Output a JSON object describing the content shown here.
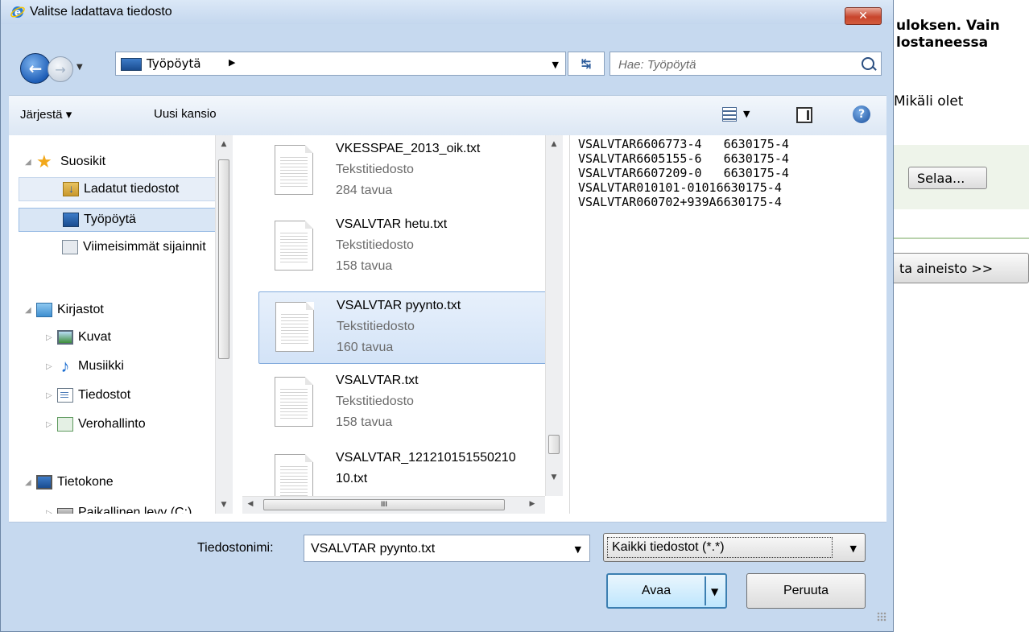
{
  "background_page": {
    "heading_line1": "uloksen. Vain",
    "heading_line2": "lostaneessa",
    "para": "Mikäli olet",
    "browse_button": "Selaa...",
    "next_button": "ta aineisto >>"
  },
  "dialog": {
    "title": "Valitse ladattava tiedosto",
    "close_label": "✕",
    "address": {
      "location": "Työpöytä",
      "search_placeholder": "Hae: Työpöytä"
    },
    "toolbar": {
      "organize_label": "Järjestä ▾",
      "new_folder_label": "Uusi kansio"
    },
    "nav_pane": {
      "favorites": "Suosikit",
      "downloads": "Ladatut tiedostot",
      "desktop": "Työpöytä",
      "recent": "Viimeisimmät sijainnit",
      "libraries": "Kirjastot",
      "pictures": "Kuvat",
      "music": "Musiikki",
      "documents": "Tiedostot",
      "verohallinto": "Verohallinto",
      "computer": "Tietokone",
      "local_disk": "Paikallinen levy (C:)"
    },
    "files": [
      {
        "name": "VKESSPAE_2013_oik.txt",
        "type": "Tekstitiedosto",
        "size": "284 tavua"
      },
      {
        "name": "VSALVTAR hetu.txt",
        "type": "Tekstitiedosto",
        "size": "158 tavua"
      },
      {
        "name": "VSALVTAR pyynto.txt",
        "type": "Tekstitiedosto",
        "size": "160 tavua"
      },
      {
        "name": "VSALVTAR.txt",
        "type": "Tekstitiedosto",
        "size": "158 tavua"
      },
      {
        "name": "VSALVTAR_121210151550210",
        "name2": "10.txt",
        "type": "",
        "size": ""
      }
    ],
    "preview_text": "VSALVTAR6606773-4   6630175-4\nVSALVTAR6605155-6   6630175-4\nVSALVTAR6607209-0   6630175-4\nVSALVTAR010101-01016630175-4\nVSALVTAR060702+939A6630175-4",
    "hscroll_label": "III",
    "filename_label": "Tiedostonimi:",
    "filename_value": "VSALVTAR pyynto.txt",
    "filetype_value": "Kaikki tiedostot (*.*)",
    "open_button": "Avaa",
    "cancel_button": "Peruuta"
  },
  "colors": {
    "dialog_frame": "#c6d9ef",
    "selection": "#d3e3f7",
    "close_red": "#c8452c"
  }
}
